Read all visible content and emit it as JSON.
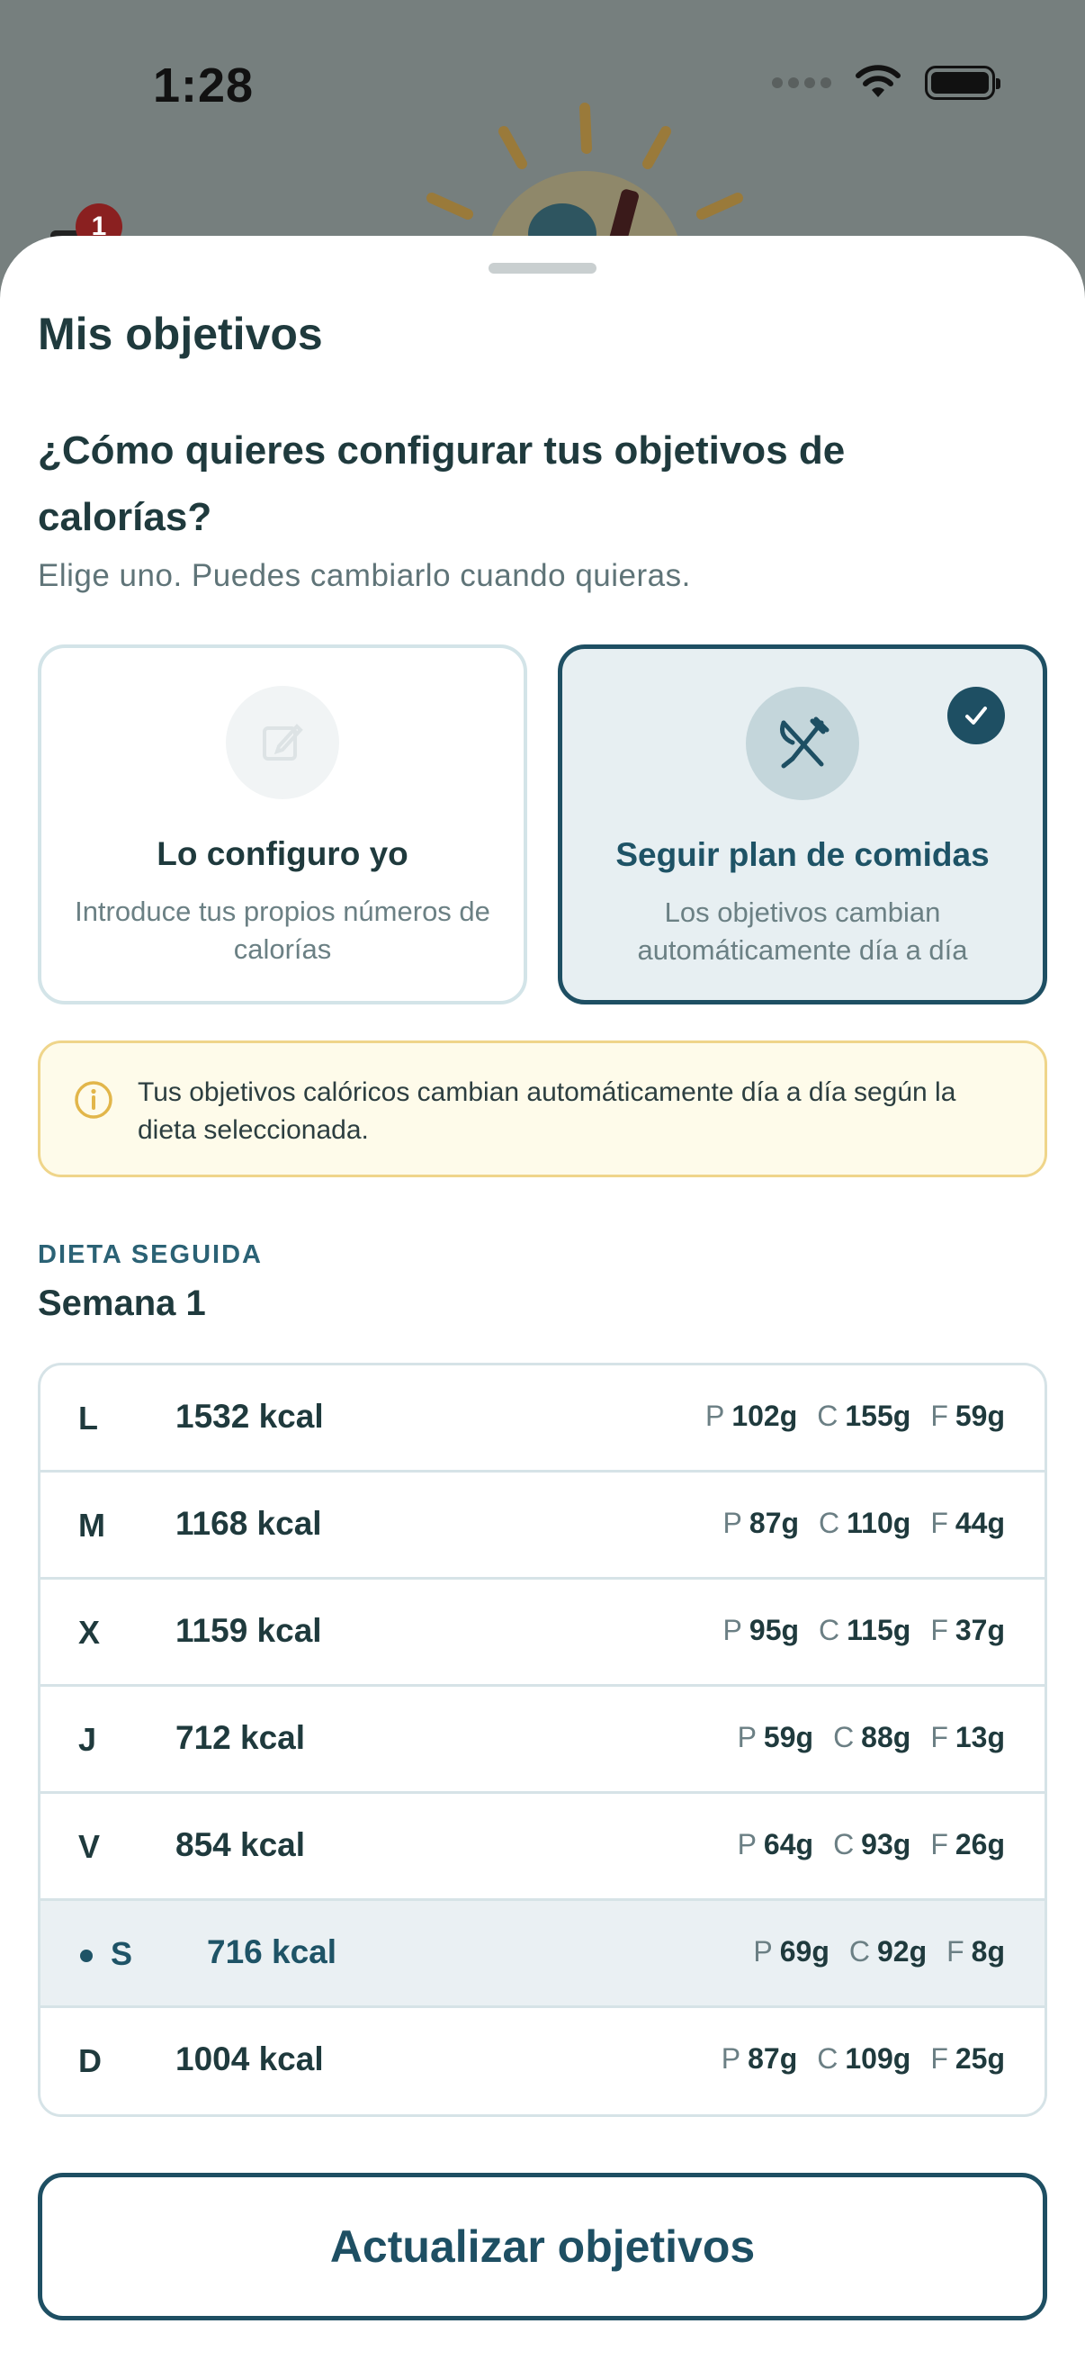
{
  "status_bar": {
    "time": "1:28",
    "icons": [
      "signal-icon",
      "wifi-icon",
      "battery-icon"
    ]
  },
  "background": {
    "notification_count": "1"
  },
  "sheet": {
    "title": "Mis objetivos",
    "question": "¿Cómo quieres configurar tus objetivos de calorías?",
    "subtitle": "Elige uno. Puedes cambiarlo cuando quieras."
  },
  "options": [
    {
      "title": "Lo configuro yo",
      "description": "Introduce tus propios números de calorías",
      "icon": "edit-icon",
      "selected": false
    },
    {
      "title": "Seguir plan de comidas",
      "description": "Los objetivos cambian automáticamente día a día",
      "icon": "utensils-icon",
      "selected": true
    }
  ],
  "info_banner": {
    "text": "Tus objetivos calóricos cambian automáticamente día a día según la dieta seleccionada.",
    "icon": "info-icon"
  },
  "diet": {
    "label": "DIETA SEGUIDA",
    "week": "Semana 1",
    "days": [
      {
        "day": "L",
        "kcal": "1532 kcal",
        "p": "102g",
        "c": "155g",
        "f": "59g",
        "today": false
      },
      {
        "day": "M",
        "kcal": "1168 kcal",
        "p": "87g",
        "c": "110g",
        "f": "44g",
        "today": false
      },
      {
        "day": "X",
        "kcal": "1159 kcal",
        "p": "95g",
        "c": "115g",
        "f": "37g",
        "today": false
      },
      {
        "day": "J",
        "kcal": "712 kcal",
        "p": "59g",
        "c": "88g",
        "f": "13g",
        "today": false
      },
      {
        "day": "V",
        "kcal": "854 kcal",
        "p": "64g",
        "c": "93g",
        "f": "26g",
        "today": false
      },
      {
        "day": "S",
        "kcal": "716 kcal",
        "p": "69g",
        "c": "92g",
        "f": "8g",
        "today": true
      },
      {
        "day": "D",
        "kcal": "1004 kcal",
        "p": "87g",
        "c": "109g",
        "f": "25g",
        "today": false
      }
    ],
    "macro_keys": {
      "p": "P",
      "c": "C",
      "f": "F"
    }
  },
  "actions": {
    "update_label": "Actualizar objetivos"
  },
  "colors": {
    "accent": "#1e4f63",
    "selected_bg": "#e7eff2",
    "banner_bg": "#fefbea",
    "banner_border": "#efd58a"
  }
}
